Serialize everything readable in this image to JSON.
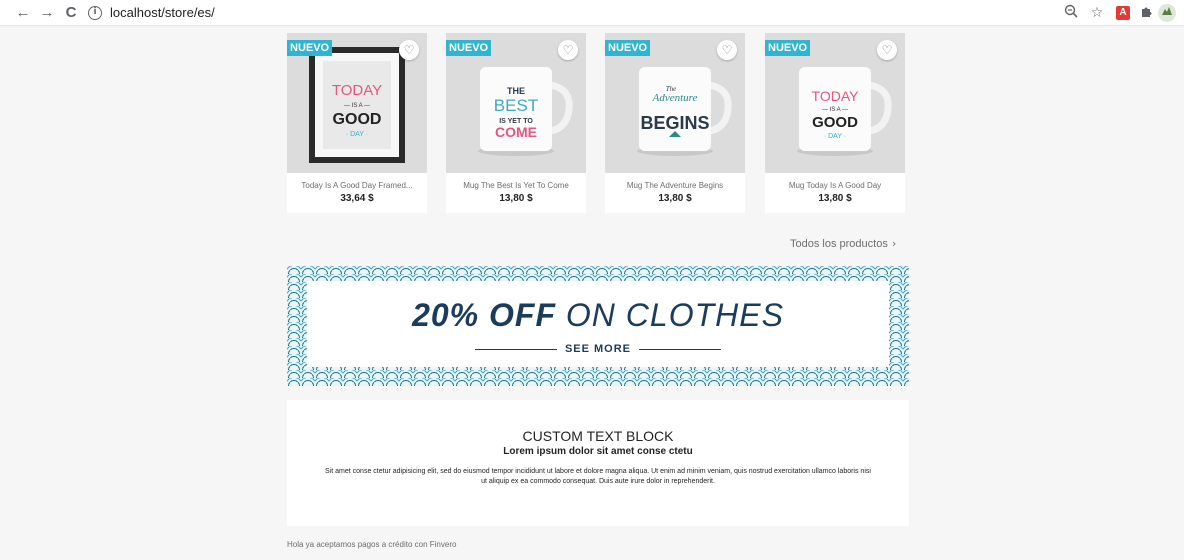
{
  "browser": {
    "url": "localhost/store/es/",
    "back": "←",
    "forward": "→",
    "reload": "C",
    "info": "i",
    "icons": [
      "zoom-icon",
      "star-icon",
      "pdf-icon",
      "extensions-icon",
      "profile-icon"
    ]
  },
  "products": [
    {
      "badge": "NUEVO",
      "name": "Today Is A Good Day Framed...",
      "price": "33,64 $",
      "art": [
        "TODAY",
        "— IS A —",
        "GOOD",
        "· DAY ·"
      ]
    },
    {
      "badge": "NUEVO",
      "name": "Mug The Best Is Yet To Come",
      "price": "13,80 $",
      "art": [
        "THE",
        "BEST",
        "IS YET TO",
        "COME"
      ]
    },
    {
      "badge": "NUEVO",
      "name": "Mug The Adventure Begins",
      "price": "13,80 $",
      "art": [
        "The",
        "Adventure",
        "BEGINS"
      ]
    },
    {
      "badge": "NUEVO",
      "name": "Mug Today Is A Good Day",
      "price": "13,80 $",
      "art": [
        "TODAY",
        "— IS A —",
        "GOOD",
        "· DAY ·"
      ]
    }
  ],
  "all_products": {
    "label": "Todos los productos",
    "chevron": "›"
  },
  "banner": {
    "bold": "20% OFF",
    "light": "ON CLOTHES",
    "cta": "SEE MORE"
  },
  "custom_block": {
    "title": "CUSTOM TEXT BLOCK",
    "subtitle": "Lorem ipsum dolor sit amet conse ctetu",
    "text": "Sit amet conse ctetur adipisicing elit, sed do eiusmod tempor incididunt ut labore et dolore magna aliqua. Ut enim ad minim veniam, quis nostrud exercitation ullamco laboris nisi ut aliquip ex ea commodo consequat. Duis aute irure dolor in reprehenderit."
  },
  "footer_note": "Hola ya aceptamos pagos a crédito con Finvero",
  "colors": {
    "badge": "#2fb5d2",
    "banner_text": "#1c3c5c",
    "background": "#f6f6f6"
  }
}
